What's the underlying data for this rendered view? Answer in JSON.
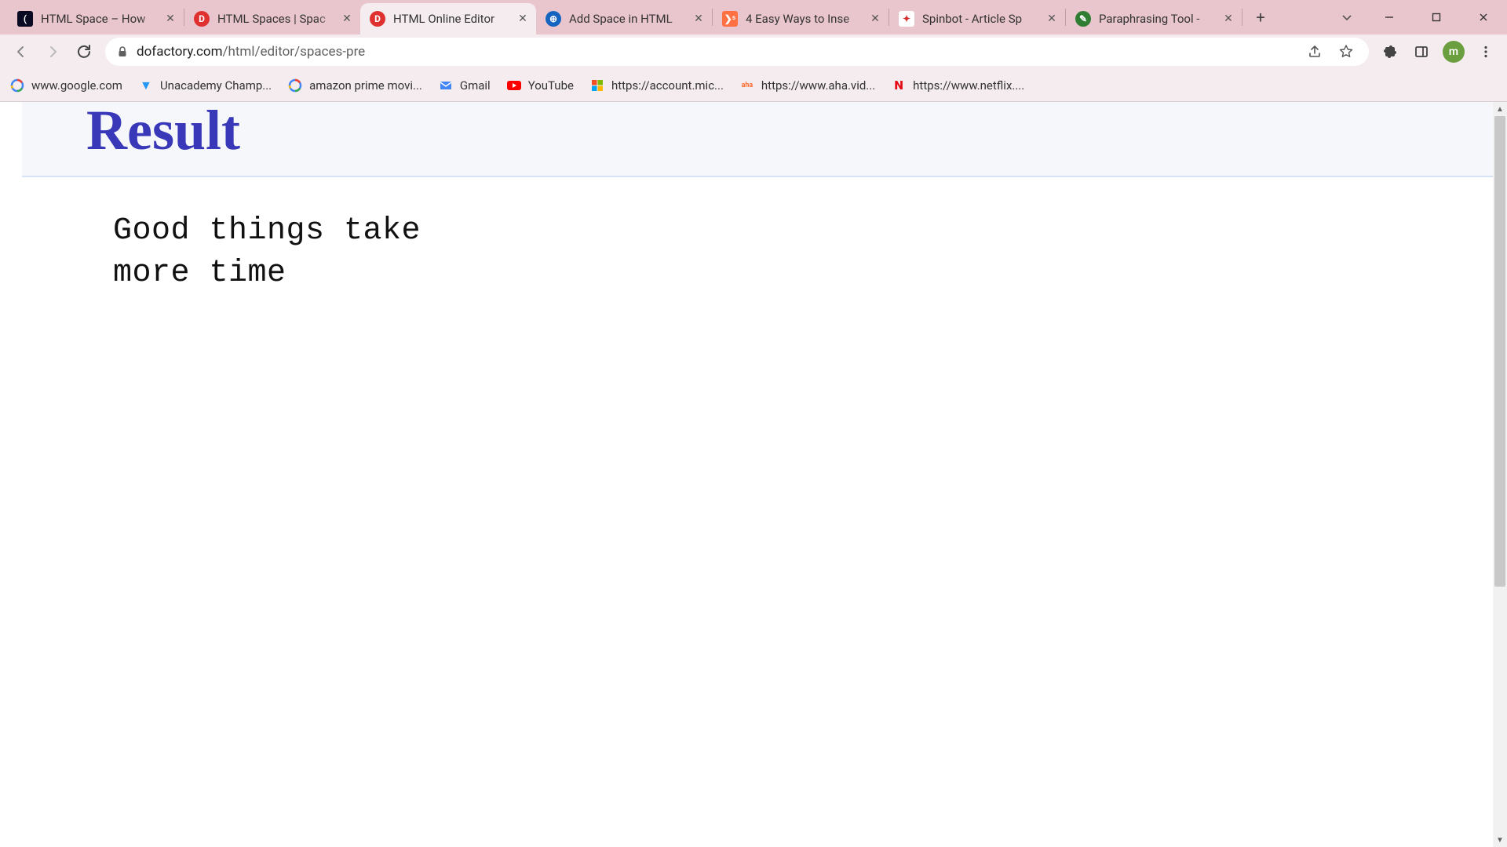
{
  "tabs": [
    {
      "title": "HTML Space – How",
      "favicon_bg": "#0a0a23",
      "favicon_text": "(",
      "favicon_color": "#ffffff"
    },
    {
      "title": "HTML Spaces | Spac",
      "favicon_bg": "#e03131",
      "favicon_text": "D",
      "favicon_color": "#ffffff"
    },
    {
      "title": "HTML Online Editor",
      "favicon_bg": "#e03131",
      "favicon_text": "D",
      "favicon_color": "#ffffff"
    },
    {
      "title": "Add Space in HTML",
      "favicon_bg": "#1565c0",
      "favicon_text": "⊕",
      "favicon_color": "#ffffff"
    },
    {
      "title": "4 Easy Ways to Inse",
      "favicon_bg": "#ff7043",
      "favicon_text": "❯ˢ",
      "favicon_color": "#ffffff"
    },
    {
      "title": "Spinbot - Article Sp",
      "favicon_bg": "#ffffff",
      "favicon_text": "✦",
      "favicon_color": "#d32f2f"
    },
    {
      "title": "Paraphrasing Tool -",
      "favicon_bg": "#2e7d32",
      "favicon_text": "✎",
      "favicon_color": "#ffffff"
    }
  ],
  "active_tab_index": 2,
  "url": {
    "host": "dofactory.com",
    "path": "/html/editor/spaces-pre"
  },
  "bookmarks": [
    {
      "label": "www.google.com",
      "icon_type": "google"
    },
    {
      "label": "Unacademy Champ...",
      "icon_type": "unacademy"
    },
    {
      "label": "amazon prime movi...",
      "icon_type": "google"
    },
    {
      "label": "Gmail",
      "icon_type": "gmail"
    },
    {
      "label": "YouTube",
      "icon_type": "youtube"
    },
    {
      "label": "https://account.mic...",
      "icon_type": "microsoft"
    },
    {
      "label": "https://www.aha.vid...",
      "icon_type": "aha"
    },
    {
      "label": "https://www.netflix....",
      "icon_type": "netflix"
    }
  ],
  "avatar_letter": "m",
  "page": {
    "heading": "Result",
    "pre_text": "Good things take\nmore time"
  }
}
